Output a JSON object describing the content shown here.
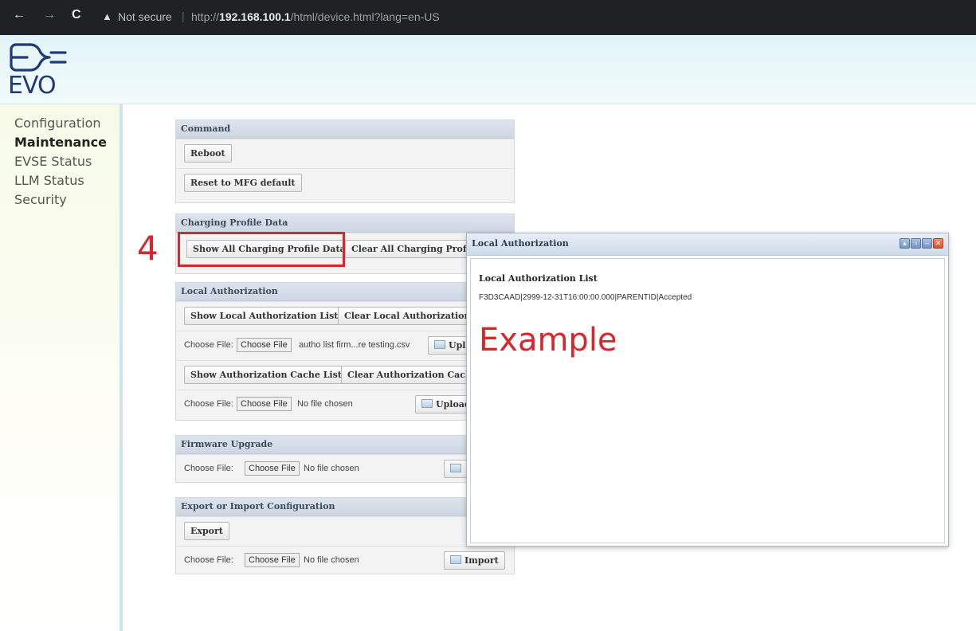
{
  "browser": {
    "back": "←",
    "forward": "→",
    "reload": "C",
    "security_warning": "Not secure",
    "url_prefix": "http://",
    "url_host": "192.168.100.1",
    "url_path": "/html/device.html?lang=en-US"
  },
  "logo": {
    "text": "EVO"
  },
  "sidebar": {
    "items": [
      {
        "label": "Configuration"
      },
      {
        "label": "Maintenance"
      },
      {
        "label": "EVSE Status"
      },
      {
        "label": "LLM Status"
      },
      {
        "label": "Security"
      }
    ]
  },
  "command": {
    "title": "Command",
    "reboot": "Reboot",
    "reset": "Reset to MFG default"
  },
  "charging_profile": {
    "title": "Charging Profile Data",
    "show_all": "Show All Charging Profile Data",
    "clear_all": "Clear All Charging Profile"
  },
  "local_auth": {
    "title": "Local Authorization",
    "show_list": "Show Local Authorization List",
    "clear_list": "Clear Local Authorization L",
    "choose_label": "Choose File:",
    "choose_button": "Choose File",
    "file_name": "autho list firm...re testing.csv",
    "upload_short": "Uplo",
    "show_cache": "Show Authorization Cache List",
    "clear_cache": "Clear Authorization Cache",
    "choose_label_2": "Choose File:",
    "choose_button_2": "Choose File",
    "file_name_2": "No file chosen",
    "upload_2": "Upload"
  },
  "firmware": {
    "title": "Firmware Upgrade",
    "choose_label": "Choose File:",
    "choose_button": "Choose File",
    "file_name": "No file chosen"
  },
  "export_import": {
    "title": "Export or Import Configuration",
    "export": "Export",
    "choose_label": "Choose File:",
    "choose_button": "Choose File",
    "file_name": "No file chosen",
    "import": "Import"
  },
  "annotation": {
    "step_number": "4",
    "highlight_color": "#d9262c"
  },
  "dialog": {
    "title": "Local Authorization",
    "subtitle": "Local Authorization List",
    "entry": "F3D3CAAD|2999-12-31T16:00:00.000|PARENTID|Accepted",
    "example_label": "Example"
  }
}
